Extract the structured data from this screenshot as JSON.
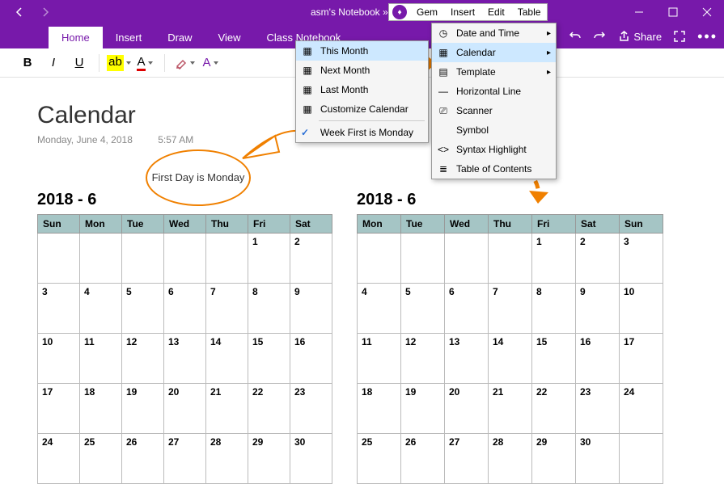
{
  "titlebar": {
    "title": "asm's Notebook » Qu…"
  },
  "ribbon": {
    "tabs": [
      "Home",
      "Insert",
      "Draw",
      "View",
      "Class Notebook"
    ],
    "share": "Share"
  },
  "gem": {
    "menus": [
      "Gem",
      "Insert",
      "Edit",
      "Table"
    ]
  },
  "page": {
    "title": "Calendar",
    "date": "Monday, June 4, 2018",
    "time": "5:57 AM"
  },
  "callout": "First Day is Monday",
  "menu1": {
    "items": [
      "This Month",
      "Next Month",
      "Last Month",
      "Customize Calendar",
      "Week First is Monday"
    ]
  },
  "menu2": {
    "items": [
      "Date and Time",
      "Calendar",
      "Template",
      "Horizontal Line",
      "Scanner",
      "Symbol",
      "Syntax Highlight",
      "Table of Contents"
    ]
  },
  "calendarLeft": {
    "title": "2018 - 6",
    "headers": [
      "Sun",
      "Mon",
      "Tue",
      "Wed",
      "Thu",
      "Fri",
      "Sat"
    ],
    "rows": [
      [
        "",
        "",
        "",
        "",
        "",
        "1",
        "2"
      ],
      [
        "3",
        "4",
        "5",
        "6",
        "7",
        "8",
        "9"
      ],
      [
        "10",
        "11",
        "12",
        "13",
        "14",
        "15",
        "16"
      ],
      [
        "17",
        "18",
        "19",
        "20",
        "21",
        "22",
        "23"
      ],
      [
        "24",
        "25",
        "26",
        "27",
        "28",
        "29",
        "30"
      ]
    ]
  },
  "calendarRight": {
    "title": "2018 - 6",
    "headers": [
      "Mon",
      "Tue",
      "Wed",
      "Thu",
      "Fri",
      "Sat",
      "Sun"
    ],
    "rows": [
      [
        "",
        "",
        "",
        "",
        "1",
        "2",
        "3"
      ],
      [
        "4",
        "5",
        "6",
        "7",
        "8",
        "9",
        "10"
      ],
      [
        "11",
        "12",
        "13",
        "14",
        "15",
        "16",
        "17"
      ],
      [
        "18",
        "19",
        "20",
        "21",
        "22",
        "23",
        "24"
      ],
      [
        "25",
        "26",
        "27",
        "28",
        "29",
        "30",
        ""
      ]
    ]
  }
}
